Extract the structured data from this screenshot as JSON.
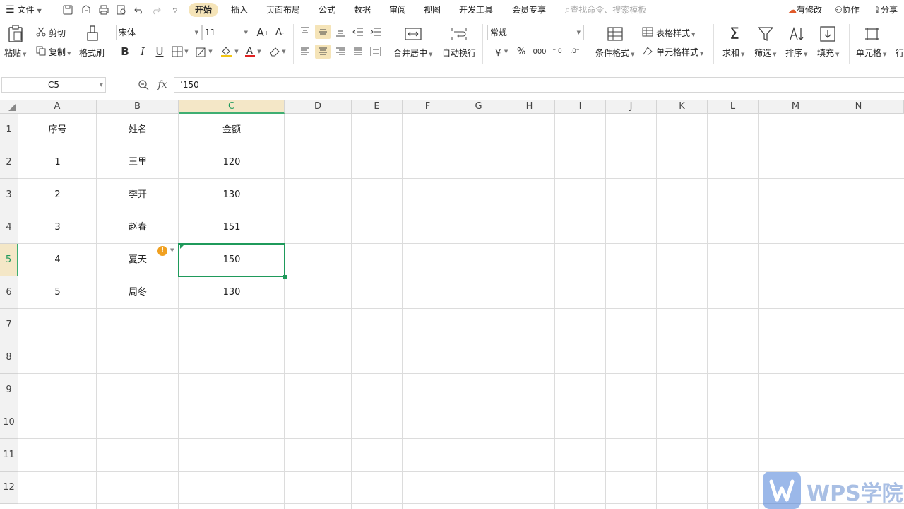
{
  "menubar": {
    "file_label": "文件",
    "tabs": [
      {
        "label": "开始",
        "active": true
      },
      {
        "label": "插入"
      },
      {
        "label": "页面布局"
      },
      {
        "label": "公式"
      },
      {
        "label": "数据"
      },
      {
        "label": "审阅"
      },
      {
        "label": "视图"
      },
      {
        "label": "开发工具"
      },
      {
        "label": "会员专享"
      }
    ],
    "search_placeholder": "查找命令、搜索模板",
    "modified_label": "有修改",
    "collab_label": "协作",
    "share_label": "分享"
  },
  "ribbon": {
    "paste_label": "粘贴",
    "cut_label": "剪切",
    "copy_label": "复制",
    "format_painter_label": "格式刷",
    "font_name": "宋体",
    "font_size": "11",
    "merge_label": "合并居中",
    "wrap_label": "自动换行",
    "number_format": "常规",
    "currency_symbol": "￥",
    "percent_symbol": "%",
    "thousands_symbol": "000",
    "table_style_label": "表格样式",
    "cell_style_label": "单元格样式",
    "cond_format_label": "条件格式",
    "sum_label": "求和",
    "filter_label": "筛选",
    "sort_label": "排序",
    "fill_label": "填充",
    "cell_label": "单元格",
    "row_col_label": "行"
  },
  "formula_bar": {
    "name_box": "C5",
    "fx_label": "fx",
    "content": "’150"
  },
  "sheet": {
    "columns": [
      "A",
      "B",
      "C",
      "D",
      "E",
      "F",
      "G",
      "H",
      "I",
      "J",
      "K",
      "L",
      "M",
      "N"
    ],
    "rows": [
      "1",
      "2",
      "3",
      "4",
      "5",
      "6",
      "7",
      "8",
      "9",
      "10",
      "11",
      "12"
    ],
    "selected_column": "C",
    "selected_row": "5",
    "cells": [
      [
        "序号",
        "姓名",
        "金额"
      ],
      [
        "1",
        "王里",
        "120"
      ],
      [
        "2",
        "李开",
        "130"
      ],
      [
        "3",
        "赵春",
        "151"
      ],
      [
        "4",
        "夏天",
        "150"
      ],
      [
        "5",
        "周冬",
        "130"
      ]
    ]
  },
  "watermark": {
    "text": "WPS学院"
  },
  "colors": {
    "accent": "#1f9a5b",
    "active_tab_bg": "#f5e4b8",
    "header_selected_bg": "#f4e7c7",
    "warning": "#f0a020"
  }
}
